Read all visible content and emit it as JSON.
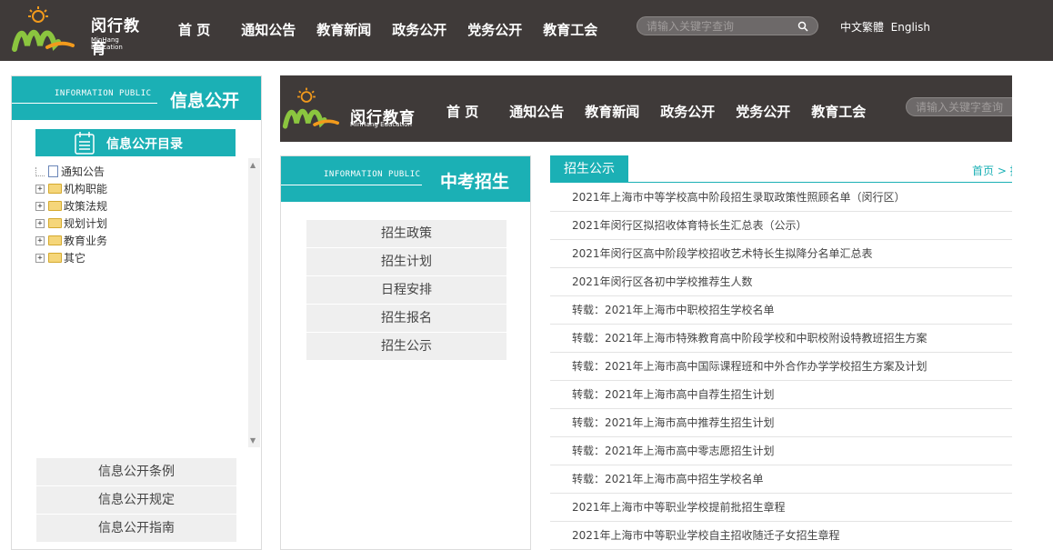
{
  "header": {
    "logo_title": "闵行教育",
    "logo_sub": "MinHang Education",
    "nav": [
      "首 页",
      "通知公告",
      "教育新闻",
      "政务公开",
      "党务公开",
      "教育工会"
    ],
    "search_placeholder": "请输入关键字查询",
    "lang_cn": "中文繁體",
    "lang_en": "English"
  },
  "left_panel": {
    "en_title": "INFORMATION PUBLIC",
    "cn_title": "信息公开",
    "catalog_label": "信息公开目录",
    "tree": [
      "通知公告",
      "机构职能",
      "政策法规",
      "规划计划",
      "教育业务",
      "其它"
    ],
    "links": [
      "信息公开条例",
      "信息公开规定",
      "信息公开指南"
    ]
  },
  "inner_header": {
    "logo_title": "闵行教育",
    "logo_sub": "MinHang Education",
    "nav": [
      "首 页",
      "通知公告",
      "教育新闻",
      "政务公开",
      "党务公开",
      "教育工会"
    ],
    "search_placeholder": "请输入关键字查询"
  },
  "mid_panel": {
    "en_title": "INFORMATION PUBLIC",
    "cn_title": "中考招生",
    "links": [
      "招生政策",
      "招生计划",
      "日程安排",
      "招生报名",
      "招生公示"
    ]
  },
  "right_panel": {
    "tab": "招生公示",
    "breadcrumb": "首页 > 招",
    "items": [
      "2021年上海市中等学校高中阶段招生录取政策性照顾名单（闵行区）",
      "2021年闵行区拟招收体育特长生汇总表（公示）",
      "2021年闵行区高中阶段学校招收艺术特长生拟降分名单汇总表",
      "2021年闵行区各初中学校推荐生人数",
      "转载：2021年上海市中职校招生学校名单",
      "转载：2021年上海市特殊教育高中阶段学校和中职校附设特教班招生方案",
      "转载：2021年上海市高中国际课程班和中外合作办学学校招生方案及计划",
      "转载：2021年上海市高中自荐生招生计划",
      "转载：2021年上海市高中推荐生招生计划",
      "转载：2021年上海市高中零志愿招生计划",
      "转载：2021年上海市高中招生学校名单",
      "2021年上海市中等职业学校提前批招生章程",
      "2021年上海市中等职业学校自主招收随迁子女招生章程"
    ]
  },
  "colors": {
    "header_bg": "#3f3a39",
    "accent": "#1bb0b5",
    "link_bg": "#efefef"
  }
}
